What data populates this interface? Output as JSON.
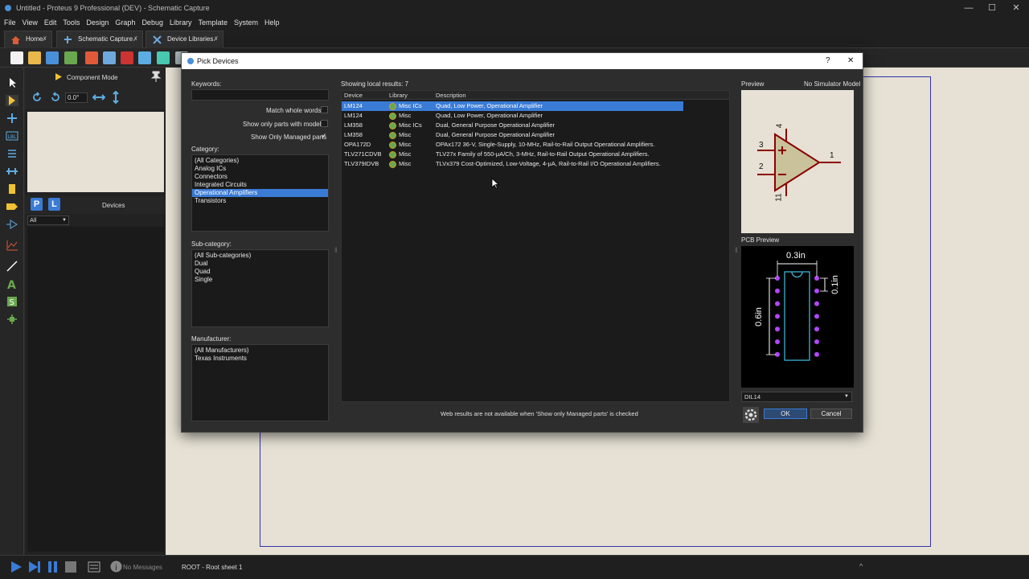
{
  "app": {
    "title": "Untitled - Proteus 9 Professional (DEV) - Schematic Capture"
  },
  "menu": [
    "File",
    "View",
    "Edit",
    "Tools",
    "Design",
    "Graph",
    "Debug",
    "Library",
    "Template",
    "System",
    "Help"
  ],
  "tabs": [
    {
      "label": "Home"
    },
    {
      "label": "Schematic Capture"
    },
    {
      "label": "Device Libraries"
    }
  ],
  "side": {
    "mode_label": "Component Mode",
    "rotation": "0.0°",
    "devices_label": "Devices",
    "p_label": "P",
    "l_label": "L",
    "filter_value": "All"
  },
  "status": {
    "messages": "No Messages",
    "sheet": "ROOT - Root sheet 1"
  },
  "dialog": {
    "title": "Pick Devices",
    "help": "?",
    "close": "✕",
    "keywords_label": "Keywords:",
    "keywords_value": "",
    "match_whole_words": "Match whole words?",
    "show_only_parts_models": "Show only parts with models?",
    "show_only_managed": "Show Only Managed parts",
    "managed_check": "✓",
    "category_label": "Category:",
    "categories": [
      "(All Categories)",
      "Analog ICs",
      "Connectors",
      "Integrated Circuits",
      "Operational Amplifiers",
      "Transistors"
    ],
    "selected_category": 4,
    "subcategory_label": "Sub-category:",
    "subcategories": [
      "(All Sub-categories)",
      "Dual",
      "Quad",
      "Single"
    ],
    "manufacturer_label": "Manufacturer:",
    "manufacturers": [
      "(All Manufacturers)",
      "Texas Instruments"
    ],
    "results_count": "Showing local results: 7",
    "columns": {
      "device": "Device",
      "library": "Library",
      "description": "Description"
    },
    "results": [
      {
        "device": "LM124",
        "library": "Misc ICs",
        "description": "Quad, Low Power, Operational Amplifier",
        "selected": true
      },
      {
        "device": "LM124",
        "library": "Misc",
        "description": "Quad, Low Power, Operational Amplifier",
        "selected": false
      },
      {
        "device": "LM358",
        "library": "Misc ICs",
        "description": "Dual, General Purpose Operational Amplifier",
        "selected": false
      },
      {
        "device": "LM358",
        "library": "Misc",
        "description": "Dual, General Purpose Operational Amplifier",
        "selected": false
      },
      {
        "device": "OPA172D",
        "library": "Misc",
        "description": "OPAx172 36-V, Single-Supply, 10-MHz, Rail-to-Rail Output Operational Amplifiers.",
        "selected": false
      },
      {
        "device": "TLV271CDVB",
        "library": "Misc",
        "description": "TLV27x Family of 550-μA/Ch, 3-MHz, Rail-to-Rail Output Operational Amplifiers.",
        "selected": false
      },
      {
        "device": "TLV379IDVB",
        "library": "Misc",
        "description": "TLVx379 Cost-Optimized, Low-Voltage, 4-μA, Rail-to-Rail I/O Operational Amplifiers.",
        "selected": false
      }
    ],
    "web_note": "Web results are not available when 'Show only Managed parts' is checked",
    "preview_label": "Preview",
    "simulator": "No Simulator Model",
    "pins": {
      "p4": "4",
      "p3": "3",
      "p2": "2",
      "p1": "1",
      "p11": "11",
      "plus": "+",
      "minus": "−"
    },
    "pcb_label": "PCB Preview",
    "pcb_dims": {
      "w": "0.3in",
      "h": "0.6in",
      "p": "0.1in"
    },
    "package": "DIL14",
    "ok": "OK",
    "cancel": "Cancel"
  },
  "colors": {
    "accent": "#3a7bd5",
    "canvas": "#e6e1d4",
    "opamp_fill": "#c9c29b",
    "opamp_stroke": "#8b0000",
    "pcb_pad": "#b347ff",
    "pcb_outline": "#40c0e0"
  }
}
